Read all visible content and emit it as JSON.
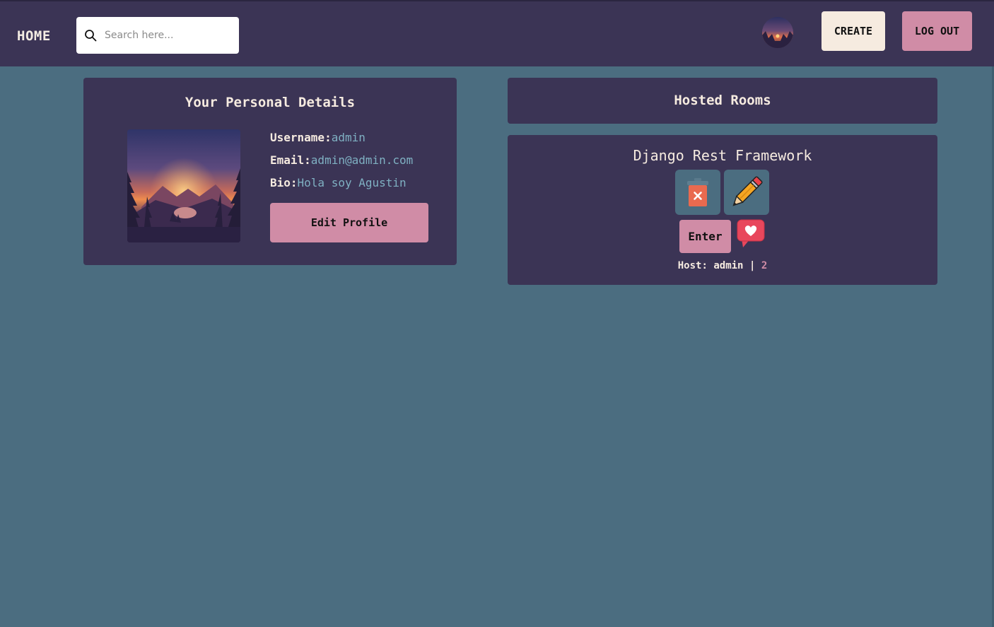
{
  "nav": {
    "home_label": "HOME",
    "search_placeholder": "Search here...",
    "create_label": "CREATE",
    "logout_label": "LOG OUT"
  },
  "profile": {
    "title": "Your Personal Details",
    "username_label": "Username:",
    "username": "admin",
    "email_label": "Email:",
    "email": "admin@admin.com",
    "bio_label": "Bio:",
    "bio": "Hola soy Agustin",
    "edit_label": "Edit Profile"
  },
  "rooms": {
    "title": "Hosted Rooms",
    "items": [
      {
        "name": "Django Rest Framework",
        "enter_label": "Enter",
        "host_prefix": "Host:",
        "host": "admin",
        "separator": "|",
        "count": "2"
      }
    ]
  },
  "icons": {
    "search": "search-icon",
    "delete": "trash-icon",
    "edit": "pencil-icon",
    "like": "heart-bubble-icon",
    "avatar": "sunset-forest-avatar"
  },
  "colors": {
    "page_bg": "#4b6d80",
    "panel_bg": "#3b3455",
    "accent_pink": "#d08ca6",
    "cream": "#f6ebe0",
    "value_blue": "#7fb0c2"
  }
}
